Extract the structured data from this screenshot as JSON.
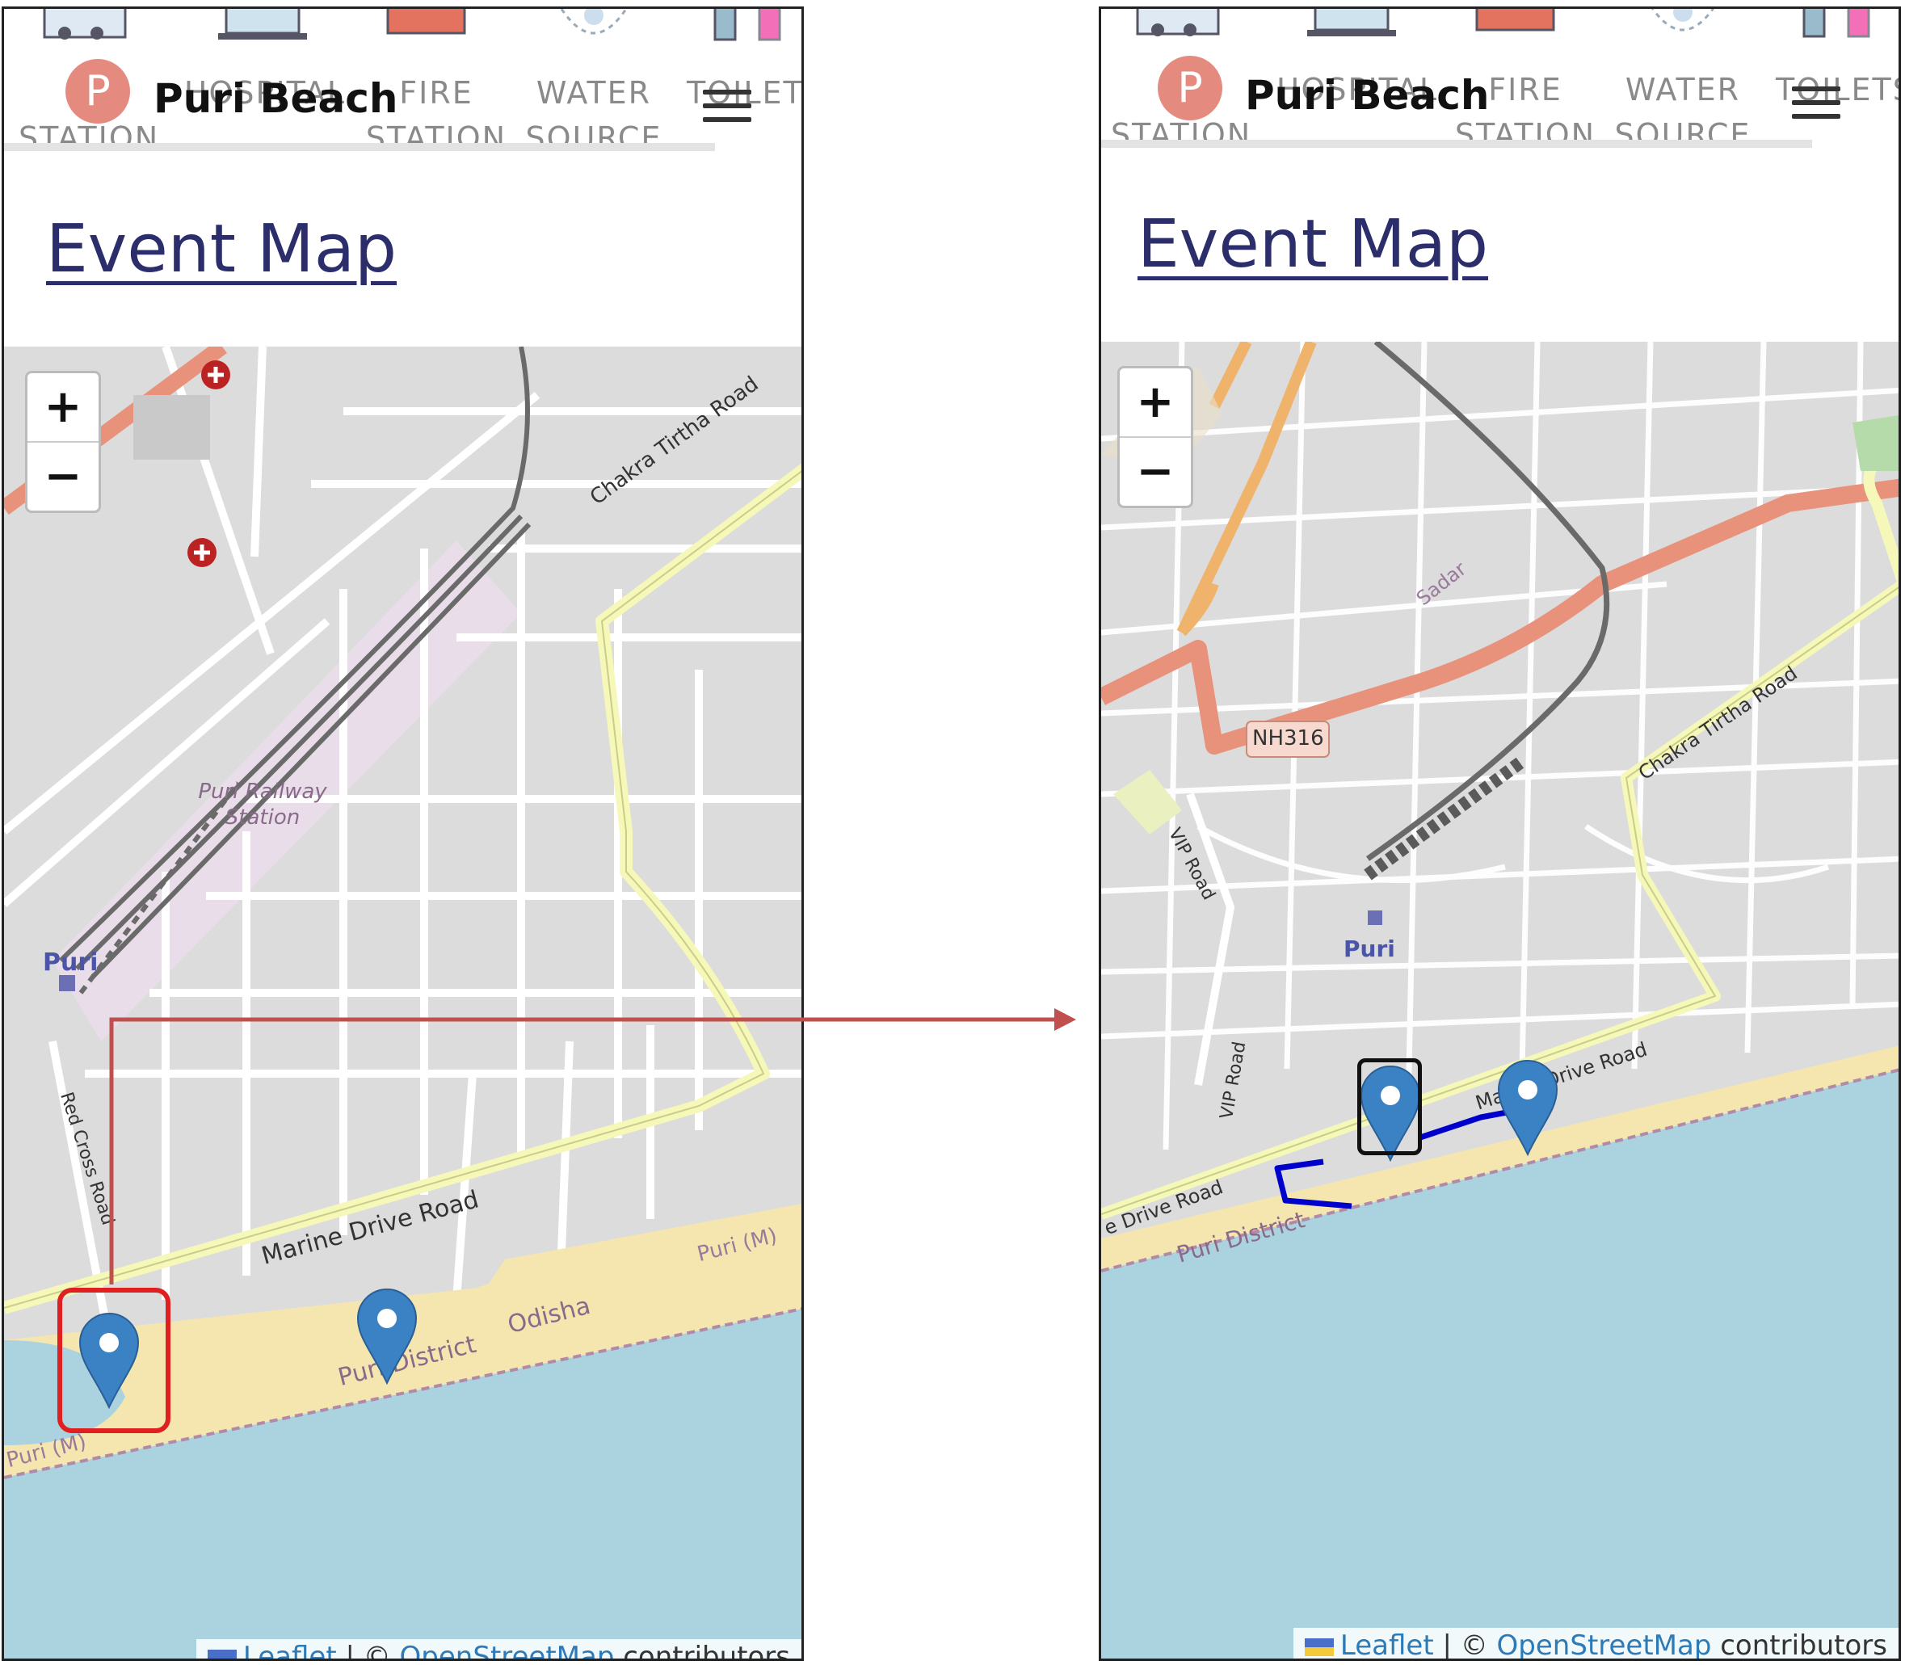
{
  "app": {
    "brand_letter": "P",
    "brand_name": "Puri Beach",
    "page_title": "Event Map"
  },
  "nav": {
    "items": [
      {
        "label": "P\nSTATION",
        "icon": "police-station-icon"
      },
      {
        "label": "HOSPITAL",
        "icon": "hospital-icon"
      },
      {
        "label": "FIRE\nSTATION",
        "icon": "fire-truck-icon"
      },
      {
        "label": "WATER\nSOURCE",
        "icon": "water-drop-icon"
      },
      {
        "label": "TOILETS",
        "icon": "toilet-icon"
      }
    ]
  },
  "map": {
    "zoom_in": "+",
    "zoom_out": "−",
    "attribution": {
      "leaflet": "Leaflet",
      "separator": "| ©",
      "osm": "OpenStreetMap",
      "suffix": "contributors"
    }
  },
  "left_map": {
    "labels": {
      "road_chakra": "Chakra Tirtha Road",
      "station": "Puri Railway Station",
      "puri": "Puri",
      "red_cross": "Red Cross Road",
      "marine_drive": "Marine Drive Road",
      "odisha": "Odisha",
      "district": "Puri District",
      "puri_m_right": "Puri (M)",
      "puri_m_left": "Puri (M)"
    }
  },
  "right_map": {
    "labels": {
      "nh": "NH316",
      "vip_top": "VIP Road",
      "vip_bottom": "VIP Road",
      "chakra": "Chakra Tirtha Road",
      "sadar": "Sadar",
      "puri": "Puri",
      "marine": "Marine Drive Road",
      "drive_left": "e Drive Road",
      "district": "Puri District"
    }
  },
  "colors": {
    "accent": "#2b2e6b",
    "marker": "#3b82c4",
    "highlight_box": "#e02020",
    "arrow": "#c0504d",
    "sea": "#aad3df",
    "beach": "#f5e6b0",
    "main_road": "#f7fabf",
    "national_road": "#e8927c",
    "route": "#0000cc"
  }
}
